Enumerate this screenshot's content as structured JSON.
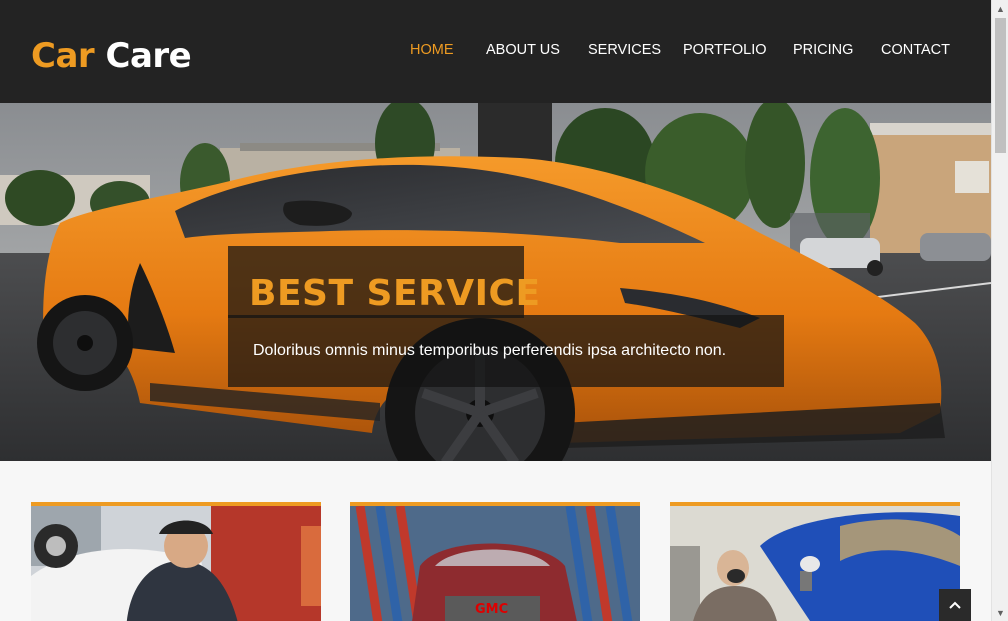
{
  "brand": {
    "part1": "Car",
    "part2": "Care",
    "accent_color": "#ee9b22"
  },
  "nav": {
    "items": [
      {
        "label": "HOME",
        "active": true
      },
      {
        "label": "ABOUT US",
        "active": false
      },
      {
        "label": "SERVICES",
        "active": false
      },
      {
        "label": "PORTFOLIO",
        "active": false
      },
      {
        "label": "PRICING",
        "active": false
      },
      {
        "label": "CONTACT",
        "active": false
      }
    ]
  },
  "hero": {
    "title": "BEST SERVICE",
    "text": "Doloribus omnis minus temporibus perferendis ipsa architecto non.",
    "image": "orange-sports-car"
  },
  "services": {
    "cards": [
      {
        "image": "mechanic-under-hood"
      },
      {
        "image": "car-wash-brushes"
      },
      {
        "image": "spray-painter"
      }
    ]
  },
  "back_to_top": {
    "icon": "chevron-up-icon"
  },
  "scrollbar": {
    "up_icon": "arrow-up-icon",
    "down_icon": "arrow-down-icon"
  }
}
